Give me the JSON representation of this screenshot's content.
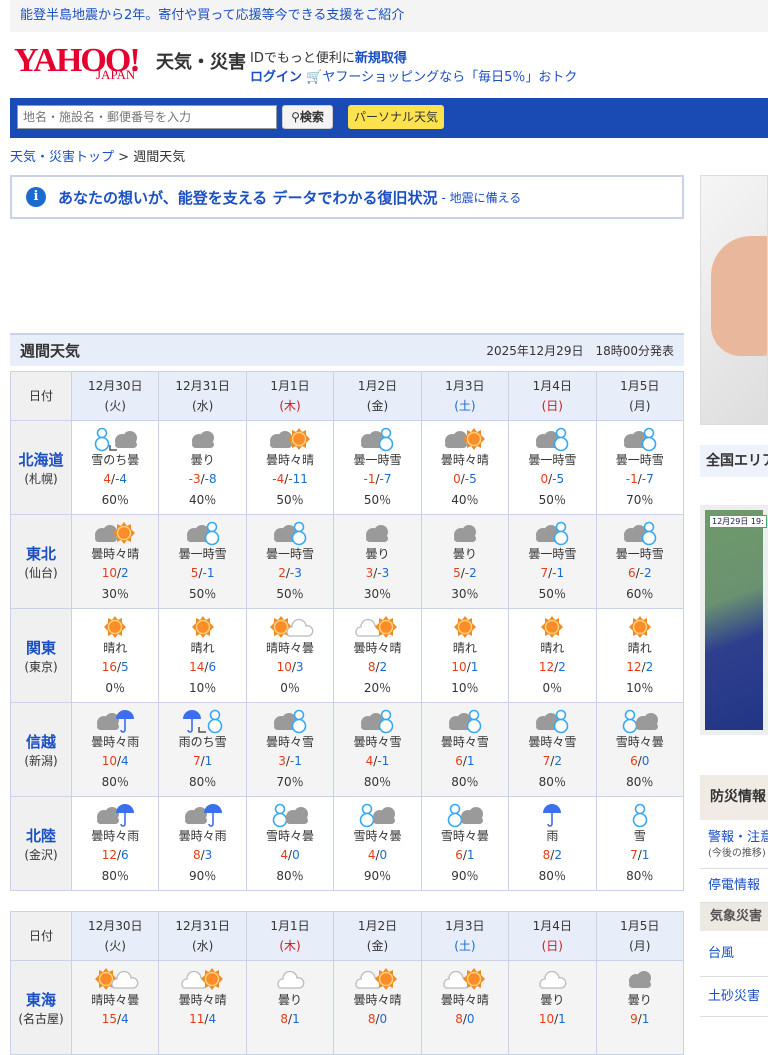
{
  "topbar": {
    "text": "能登半島地震から2年。寄付や買って応援等今できる支援をご紹介"
  },
  "header": {
    "logo": "YAHOO! JAPAN",
    "logo_main": "YAHOO!",
    "logo_sub": "JAPAN",
    "service": "天気・災害",
    "id_text": "IDでもっと便利に",
    "id_link": "新規取得",
    "login": "ログイン",
    "shopping": "ヤフーショッピングなら「毎日5％」おトク"
  },
  "search": {
    "placeholder": "地名・施設名・郵便番号を入力",
    "button": "検索",
    "personal": "パーソナル天気"
  },
  "breadcrumb": {
    "home": "天気・災害トップ",
    "sep": " > ",
    "current": "週間天気"
  },
  "notice": {
    "main": "あなたの想いが、能登を支える データでわかる復旧状況",
    "sub": "- 地震に備える"
  },
  "weekly": {
    "title": "週間天気",
    "issued": "2025年12月29日　18時00分発表",
    "date_label": "日付",
    "days": [
      {
        "date": "12月30日",
        "wd": "(火)",
        "cls": ""
      },
      {
        "date": "12月31日",
        "wd": "(水)",
        "cls": ""
      },
      {
        "date": "1月1日",
        "wd": "(木)",
        "cls": "wd-thu"
      },
      {
        "date": "1月2日",
        "wd": "(金)",
        "cls": ""
      },
      {
        "date": "1月3日",
        "wd": "(土)",
        "cls": "wd-sat"
      },
      {
        "date": "1月4日",
        "wd": "(日)",
        "cls": "wd-sun"
      },
      {
        "date": "1月5日",
        "wd": "(月)",
        "cls": ""
      }
    ],
    "tables": [
      [
        {
          "region": "北海道",
          "city": "(札幌)",
          "cells": [
            {
              "icon": "snow-later-cloud",
              "text": "雪のち曇",
              "hi": "4",
              "lo": "-4",
              "pop": "60％"
            },
            {
              "icon": "cloud",
              "text": "曇り",
              "hi": "-3",
              "lo": "-8",
              "pop": "40％"
            },
            {
              "icon": "cloud-sun",
              "text": "曇時々晴",
              "hi": "-4",
              "lo": "-11",
              "pop": "50％"
            },
            {
              "icon": "cloud-snow",
              "text": "曇一時雪",
              "hi": "-1",
              "lo": "-7",
              "pop": "50％"
            },
            {
              "icon": "cloud-sun",
              "text": "曇時々晴",
              "hi": "0",
              "lo": "-5",
              "pop": "40％"
            },
            {
              "icon": "cloud-snow",
              "text": "曇一時雪",
              "hi": "0",
              "lo": "-5",
              "pop": "50％"
            },
            {
              "icon": "cloud-snow",
              "text": "曇一時雪",
              "hi": "-1",
              "lo": "-7",
              "pop": "70％"
            }
          ]
        },
        {
          "region": "東北",
          "city": "(仙台)",
          "cells": [
            {
              "icon": "cloud-sun",
              "text": "曇時々晴",
              "hi": "10",
              "lo": "2",
              "pop": "30％"
            },
            {
              "icon": "cloud-snow",
              "text": "曇一時雪",
              "hi": "5",
              "lo": "-1",
              "pop": "50％"
            },
            {
              "icon": "cloud-snow",
              "text": "曇一時雪",
              "hi": "2",
              "lo": "-3",
              "pop": "50％"
            },
            {
              "icon": "cloud",
              "text": "曇り",
              "hi": "3",
              "lo": "-3",
              "pop": "30％"
            },
            {
              "icon": "cloud",
              "text": "曇り",
              "hi": "5",
              "lo": "-2",
              "pop": "30％"
            },
            {
              "icon": "cloud-snow",
              "text": "曇一時雪",
              "hi": "7",
              "lo": "-1",
              "pop": "50％"
            },
            {
              "icon": "cloud-snow",
              "text": "曇一時雪",
              "hi": "6",
              "lo": "-2",
              "pop": "60％"
            }
          ]
        },
        {
          "region": "関東",
          "city": "(東京)",
          "cells": [
            {
              "icon": "sun",
              "text": "晴れ",
              "hi": "16",
              "lo": "5",
              "pop": "0％"
            },
            {
              "icon": "sun",
              "text": "晴れ",
              "hi": "14",
              "lo": "6",
              "pop": "10％"
            },
            {
              "icon": "sun-cloudo",
              "text": "晴時々曇",
              "hi": "10",
              "lo": "3",
              "pop": "0％"
            },
            {
              "icon": "cloudo-sun",
              "text": "曇時々晴",
              "hi": "8",
              "lo": "2",
              "pop": "20％"
            },
            {
              "icon": "sun",
              "text": "晴れ",
              "hi": "10",
              "lo": "1",
              "pop": "10％"
            },
            {
              "icon": "sun",
              "text": "晴れ",
              "hi": "12",
              "lo": "2",
              "pop": "0％"
            },
            {
              "icon": "sun",
              "text": "晴れ",
              "hi": "12",
              "lo": "2",
              "pop": "10％"
            }
          ]
        },
        {
          "region": "信越",
          "city": "(新潟)",
          "cells": [
            {
              "icon": "cloud-rain",
              "text": "曇時々雨",
              "hi": "10",
              "lo": "4",
              "pop": "80％"
            },
            {
              "icon": "rain-later-snow",
              "text": "雨のち雪",
              "hi": "7",
              "lo": "1",
              "pop": "80％"
            },
            {
              "icon": "cloud-snow",
              "text": "曇時々雪",
              "hi": "3",
              "lo": "-1",
              "pop": "70％"
            },
            {
              "icon": "cloud-snow",
              "text": "曇時々雪",
              "hi": "4",
              "lo": "-1",
              "pop": "80％"
            },
            {
              "icon": "cloud-snow",
              "text": "曇時々雪",
              "hi": "6",
              "lo": "1",
              "pop": "80％"
            },
            {
              "icon": "cloud-snow",
              "text": "曇時々雪",
              "hi": "7",
              "lo": "2",
              "pop": "80％"
            },
            {
              "icon": "snow-cloud",
              "text": "雪時々曇",
              "hi": "6",
              "lo": "0",
              "pop": "80％"
            }
          ]
        },
        {
          "region": "北陸",
          "city": "(金沢)",
          "cells": [
            {
              "icon": "cloud-rain",
              "text": "曇時々雨",
              "hi": "12",
              "lo": "6",
              "pop": "80％"
            },
            {
              "icon": "cloud-rain",
              "text": "曇時々雨",
              "hi": "8",
              "lo": "3",
              "pop": "90％"
            },
            {
              "icon": "snow-cloud",
              "text": "雪時々曇",
              "hi": "4",
              "lo": "0",
              "pop": "80％"
            },
            {
              "icon": "snow-cloud",
              "text": "雪時々曇",
              "hi": "4",
              "lo": "0",
              "pop": "90％"
            },
            {
              "icon": "snow-cloud",
              "text": "雪時々曇",
              "hi": "6",
              "lo": "1",
              "pop": "90％"
            },
            {
              "icon": "rain",
              "text": "雨",
              "hi": "8",
              "lo": "2",
              "pop": "80％"
            },
            {
              "icon": "snow",
              "text": "雪",
              "hi": "7",
              "lo": "1",
              "pop": "80％"
            }
          ]
        }
      ],
      [
        {
          "region": "東海",
          "city": "(名古屋)",
          "cells": [
            {
              "icon": "sun-cloudo",
              "text": "晴時々曇",
              "hi": "15",
              "lo": "4",
              "pop": ""
            },
            {
              "icon": "cloudo-sun",
              "text": "曇時々晴",
              "hi": "11",
              "lo": "4",
              "pop": ""
            },
            {
              "icon": "cloudo",
              "text": "曇り",
              "hi": "8",
              "lo": "1",
              "pop": ""
            },
            {
              "icon": "cloudo-sun",
              "text": "曇時々晴",
              "hi": "8",
              "lo": "0",
              "pop": ""
            },
            {
              "icon": "cloudo-sun",
              "text": "曇時々晴",
              "hi": "8",
              "lo": "0",
              "pop": ""
            },
            {
              "icon": "cloudo",
              "text": "曇り",
              "hi": "10",
              "lo": "1",
              "pop": ""
            },
            {
              "icon": "cloud",
              "text": "曇り",
              "hi": "9",
              "lo": "1",
              "pop": ""
            }
          ]
        }
      ]
    ]
  },
  "sidebar": {
    "area_title": "全国エリア",
    "sat_time": "12月29日 19:",
    "bousai_title": "防災情報",
    "links": [
      {
        "label": "警報・注意報",
        "sub": "(今後の推移)"
      },
      {
        "label": "停電情報"
      }
    ],
    "section": "気象災害",
    "links2": [
      {
        "label": "台風"
      },
      {
        "label": "土砂災害"
      }
    ]
  },
  "colors": {
    "accent": "#1a4fc4",
    "bar": "#1a4bb5",
    "personal": "#fde24f",
    "hi": "#e63d16",
    "lo": "#1a6ad0",
    "sun": "#f08a24"
  }
}
